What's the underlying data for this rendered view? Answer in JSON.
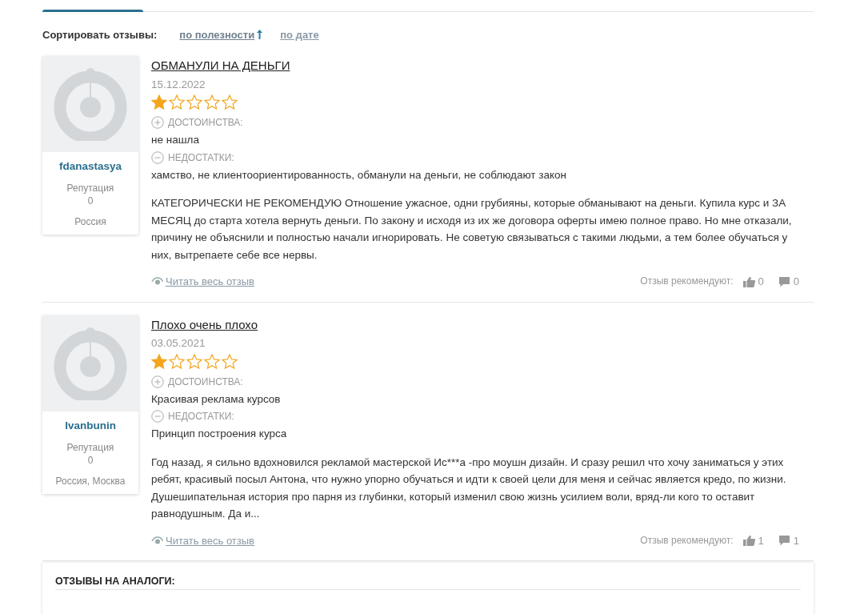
{
  "sort": {
    "label": "Сортировать отзывы:",
    "options": [
      {
        "label": "по полезности",
        "selected": true
      },
      {
        "label": "по дате",
        "selected": false
      }
    ]
  },
  "reviews": [
    {
      "author": "fdanastasya",
      "reputation_label": "Репутация",
      "reputation": "0",
      "location": "Россия",
      "title": "ОБМАНУЛИ НА ДЕНЬГИ",
      "date": "15.12.2022",
      "stars": 1,
      "pros_label": "ДОСТОИНСТВА:",
      "pros": "не нашла",
      "cons_label": "НЕДОСТАТКИ:",
      "cons": "хамство, не клиентоориентированность, обманули на деньги, не соблюдают закон",
      "body": "КАТЕГОРИЧЕСКИ НЕ РЕКОМЕНДУЮ Отношение ужасное, одни грубияны, которые обманывают на деньги. Купила курс и ЗА МЕСЯЦ до старта хотела вернуть деньги. По закону и исходя из их же договора оферты имею полное право. Но мне отказали, причину не объяснили и полностью начали игнорировать. Не советую связываться с такими людьми, а тем более обучаться у них, вытрепаете себе все нервы.",
      "read_more": "Читать весь отзыв",
      "recommend_label": "Отзыв рекомендуют:",
      "likes": "0",
      "comments": "0"
    },
    {
      "author": "Ivanbunin",
      "reputation_label": "Репутация",
      "reputation": "0",
      "location": "Россия, Москва",
      "title": "Плохо очень плохо",
      "date": "03.05.2021",
      "stars": 1,
      "pros_label": "ДОСТОИНСТВА:",
      "pros": "Красивая реклама курсов",
      "cons_label": "НЕДОСТАТКИ:",
      "cons": "Принцип построения курса",
      "body": "Год назад, я сильно вдохновился рекламой мастерской Ис***а -про моушн дизайн. И сразу решил что хочу заниматься у этих ребят, красивый посыл Антона, что нужно упорно обучаться и идти к своей цели для меня и сейчас является кредо, по жизни. Душешипательная история про парня из глубинки, который изменил свою жизнь усилием воли, вряд-ли кого то оставит равнодушным. Да и...",
      "read_more": "Читать весь отзыв",
      "recommend_label": "Отзыв рекомендуют:",
      "likes": "1",
      "comments": "1"
    }
  ],
  "analogs": {
    "title": "ОТЗЫВЫ НА АНАЛОГИ:"
  }
}
